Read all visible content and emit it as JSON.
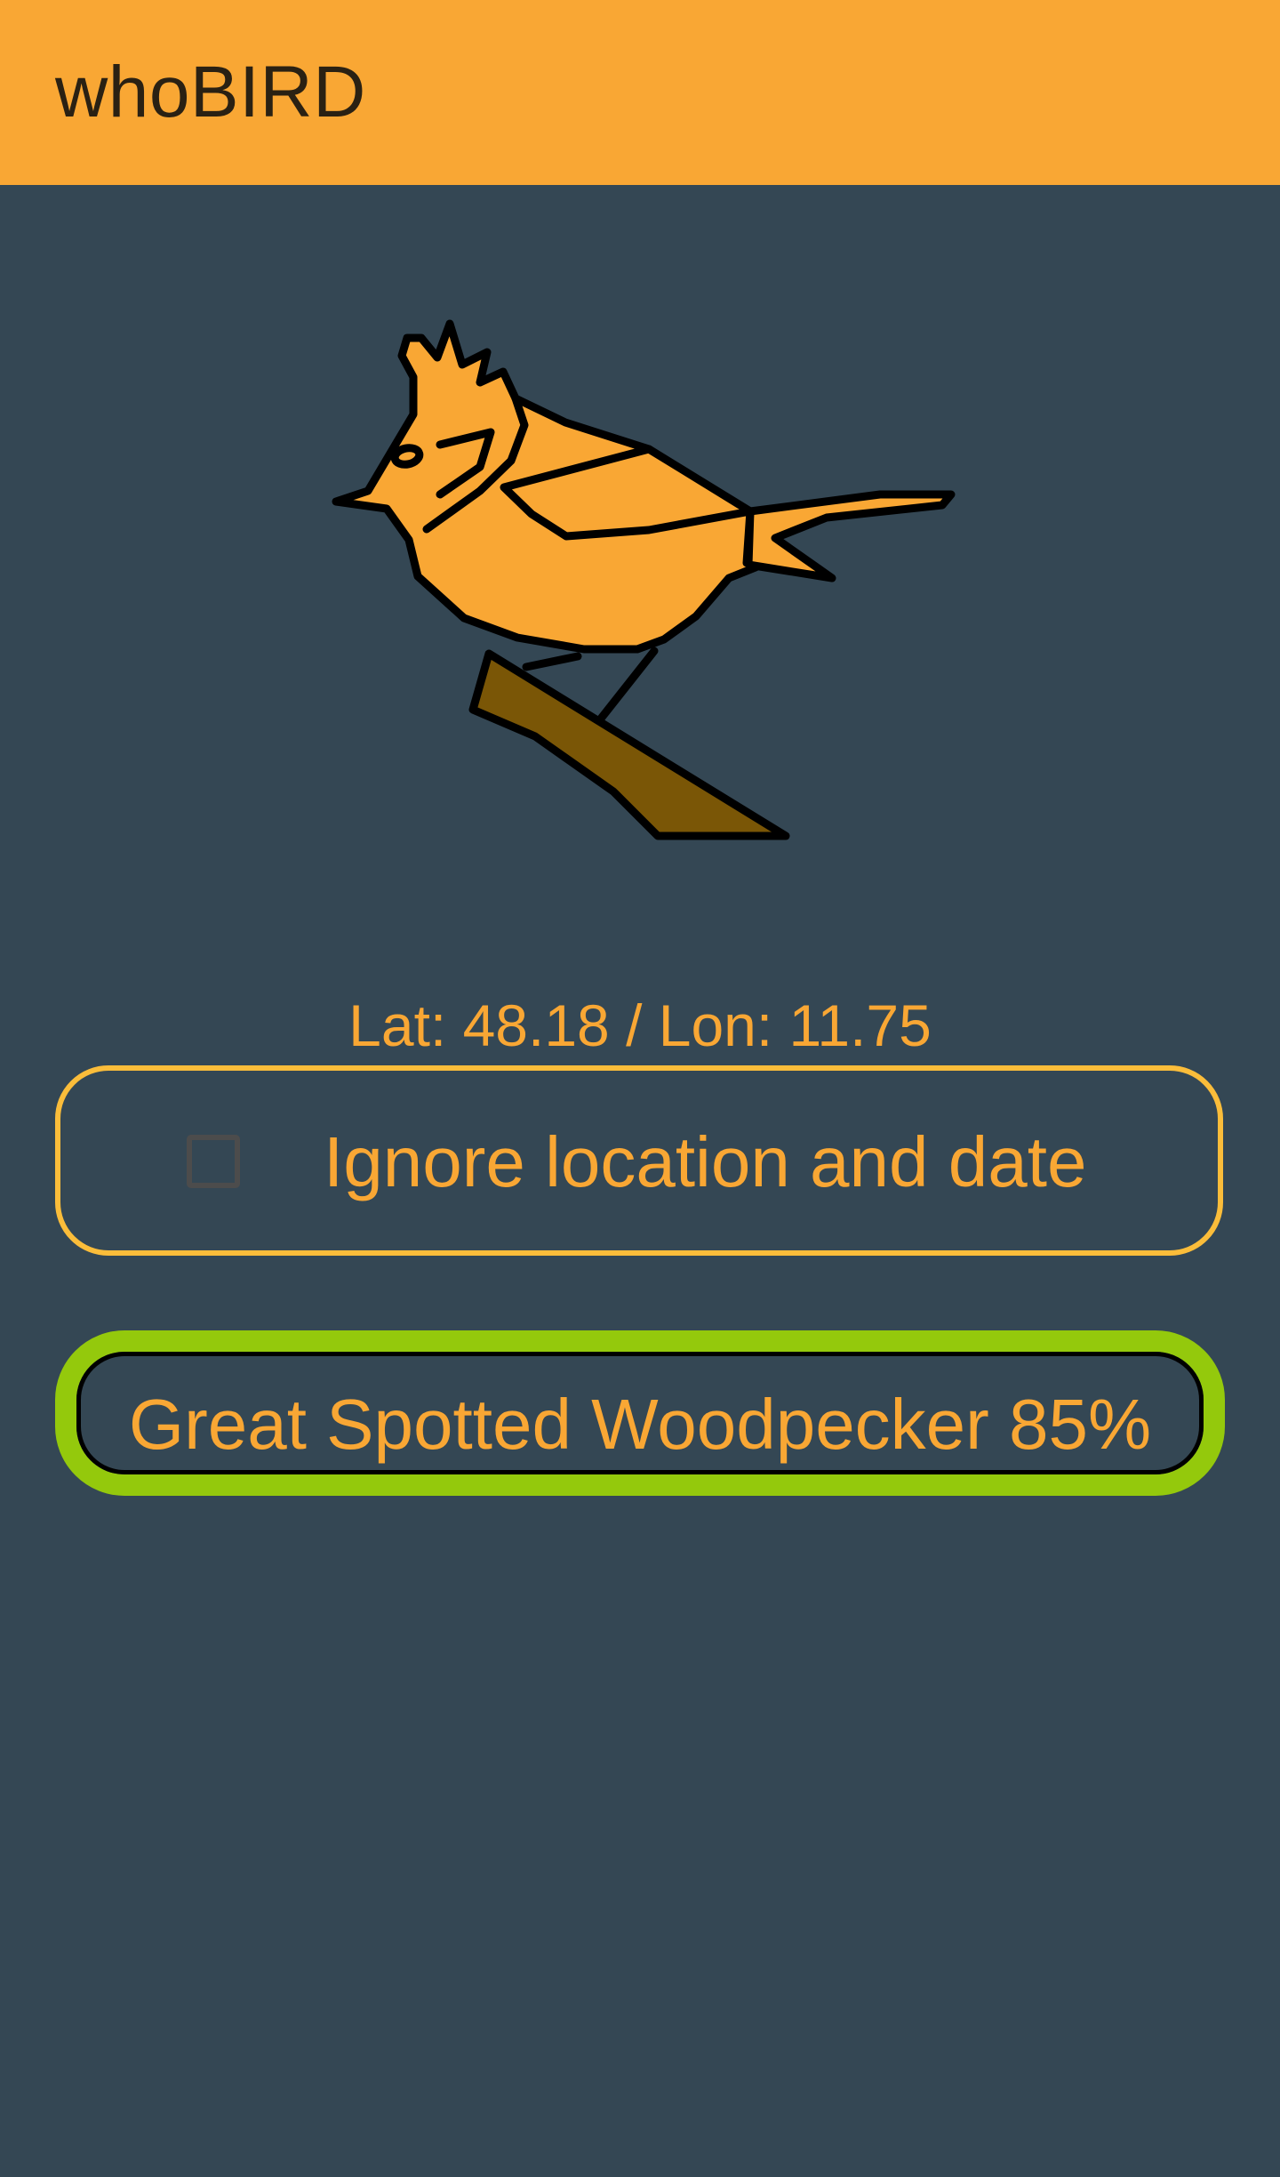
{
  "app": {
    "title": "whoBIRD"
  },
  "logo": {
    "icon": "bird-on-branch-icon",
    "body_color": "#f9a734",
    "branch_color": "#7a5606",
    "outline_color": "#000000"
  },
  "location": {
    "text": "Lat: 48.18 / Lon: 11.75"
  },
  "ignore_option": {
    "label": "Ignore location and date",
    "checked": false
  },
  "result": {
    "species": "Great Spotted Woodpecker",
    "confidence": "85%",
    "text": "Great Spotted Woodpecker  85%",
    "highlight_color": "#94c90c"
  },
  "colors": {
    "app_bar": "#f9a734",
    "background": "#344754",
    "accent_text": "#f9a734",
    "border_yellow": "#fbbd3a"
  }
}
